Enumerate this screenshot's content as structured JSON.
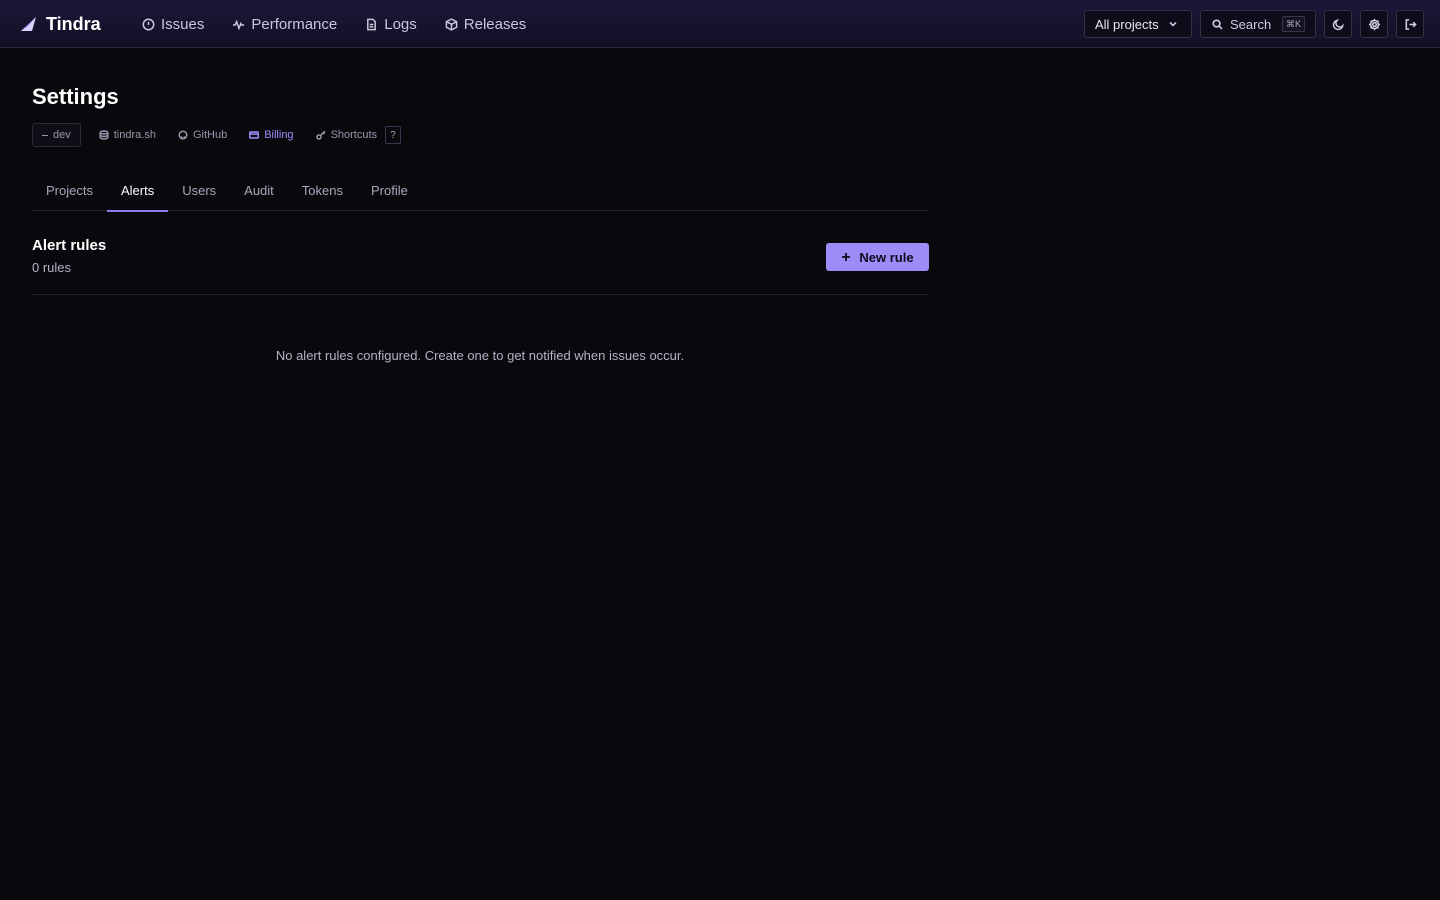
{
  "app": {
    "name": "Tindra",
    "logo_icon": "tindra-logo-icon"
  },
  "nav": {
    "items": [
      {
        "label": "Issues",
        "icon": "alert-circle-icon"
      },
      {
        "label": "Performance",
        "icon": "activity-icon"
      },
      {
        "label": "Logs",
        "icon": "file-text-icon"
      },
      {
        "label": "Releases",
        "icon": "package-icon"
      }
    ]
  },
  "toolbar": {
    "project_select": {
      "value": "All projects",
      "icon": "chevron-down-icon"
    },
    "search": {
      "label": "Search",
      "shortcut": "⌘K",
      "icon": "search-icon"
    },
    "theme_icon": "moon-icon",
    "settings_icon": "gear-icon",
    "logout_icon": "logout-icon"
  },
  "page": {
    "title": "Settings",
    "meta": {
      "env": "dev",
      "links": [
        {
          "label": "tindra.sh",
          "icon": "database-icon"
        },
        {
          "label": "GitHub",
          "icon": "github-icon"
        },
        {
          "label": "Billing",
          "icon": "credit-card-icon"
        },
        {
          "label": "Shortcuts",
          "icon": "key-icon"
        }
      ],
      "shortcut_key": "?"
    },
    "tabs": [
      "Projects",
      "Alerts",
      "Users",
      "Audit",
      "Tokens",
      "Profile"
    ],
    "active_tab": "Alerts"
  },
  "alerts": {
    "title": "Alert rules",
    "count_label": "0 rules",
    "new_button": "New rule",
    "empty_message": "No alert rules configured. Create one to get notified when issues occur."
  },
  "colors": {
    "background": "#08080d",
    "accent": "#9b8cf8",
    "accent_text": "#a58cff",
    "topbar": "#1c1638"
  }
}
